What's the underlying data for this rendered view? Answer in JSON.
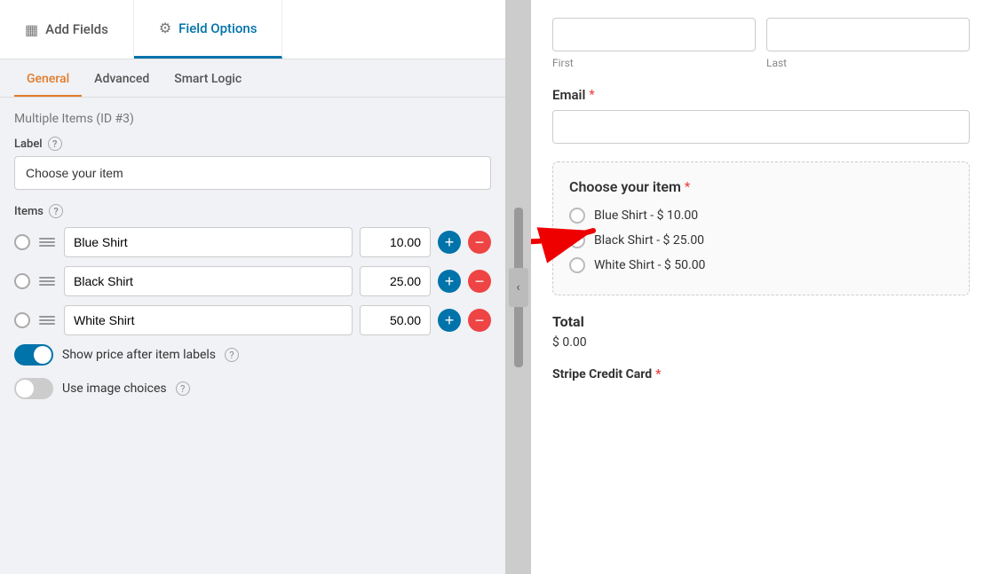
{
  "tabs": {
    "add_fields": "Add Fields",
    "field_options": "Field Options"
  },
  "sub_tabs": [
    "General",
    "Advanced",
    "Smart Logic"
  ],
  "active_sub_tab": "General",
  "section": {
    "title": "Multiple Items",
    "id": "(ID #3)"
  },
  "label_field": {
    "label": "Label",
    "value": "Choose your item"
  },
  "items_section": {
    "label": "Items"
  },
  "items": [
    {
      "name": "Blue Shirt",
      "price": "10.00"
    },
    {
      "name": "Black Shirt",
      "price": "25.00"
    },
    {
      "name": "White Shirt",
      "price": "50.00"
    }
  ],
  "toggles": [
    {
      "label": "Show price after item labels",
      "state": "on"
    },
    {
      "label": "Use image choices",
      "state": "off"
    }
  ],
  "right_panel": {
    "email_label": "Email",
    "choose_item_label": "Choose your item",
    "radio_options": [
      "Blue Shirt - $ 10.00",
      "Black Shirt - $ 25.00",
      "White Shirt - $ 50.00"
    ],
    "total_label": "Total",
    "total_value": "$ 0.00",
    "stripe_label": "Stripe Credit Card",
    "first_label": "First",
    "last_label": "Last"
  }
}
